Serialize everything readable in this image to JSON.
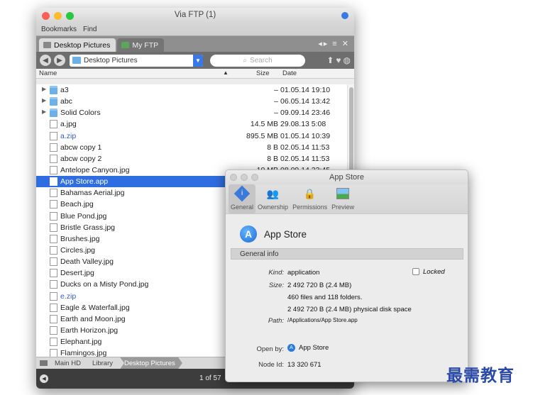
{
  "window": {
    "title": "Via FTP (1)"
  },
  "menu": [
    "Bookmarks",
    "Find"
  ],
  "tabs": [
    {
      "label": "Desktop Pictures"
    },
    {
      "label": "My FTP"
    }
  ],
  "toolbar": {
    "path": "Desktop Pictures",
    "search_placeholder": "Search"
  },
  "columns": {
    "name": "Name",
    "size": "Size",
    "date": "Date"
  },
  "files": [
    {
      "name": "a3",
      "size": "–",
      "date": "01.05.14 19:10",
      "type": "folder"
    },
    {
      "name": "abc",
      "size": "–",
      "date": "06.05.14 13:42",
      "type": "folder"
    },
    {
      "name": "Solid Colors",
      "size": "–",
      "date": "09.09.14 23:46",
      "type": "folder"
    },
    {
      "name": "a.jpg",
      "size": "14.5 MB",
      "date": "29.08.13 5:08",
      "type": "file"
    },
    {
      "name": "a.zip",
      "size": "895.5 MB",
      "date": "01.05.14 10:39",
      "type": "zip"
    },
    {
      "name": "abcw copy 1",
      "size": "8 B",
      "date": "02.05.14 11:53",
      "type": "file"
    },
    {
      "name": "abcw copy 2",
      "size": "8 B",
      "date": "02.05.14 11:53",
      "type": "file"
    },
    {
      "name": "Antelope Canyon.jpg",
      "size": "10 MB",
      "date": "08.09.14 23:45",
      "type": "file"
    },
    {
      "name": "App Store.app",
      "size": "",
      "date": "",
      "type": "file",
      "selected": true
    },
    {
      "name": "Bahamas Aerial.jpg",
      "size": "",
      "date": "",
      "type": "file"
    },
    {
      "name": "Beach.jpg",
      "size": "",
      "date": "",
      "type": "file"
    },
    {
      "name": "Blue Pond.jpg",
      "size": "",
      "date": "",
      "type": "file"
    },
    {
      "name": "Bristle Grass.jpg",
      "size": "",
      "date": "",
      "type": "file"
    },
    {
      "name": "Brushes.jpg",
      "size": "",
      "date": "",
      "type": "file"
    },
    {
      "name": "Circles.jpg",
      "size": "",
      "date": "",
      "type": "file"
    },
    {
      "name": "Death Valley.jpg",
      "size": "",
      "date": "",
      "type": "file"
    },
    {
      "name": "Desert.jpg",
      "size": "",
      "date": "",
      "type": "file"
    },
    {
      "name": "Ducks on a Misty Pond.jpg",
      "size": "",
      "date": "",
      "type": "file"
    },
    {
      "name": "e.zip",
      "size": "",
      "date": "",
      "type": "zip"
    },
    {
      "name": "Eagle & Waterfall.jpg",
      "size": "",
      "date": "",
      "type": "file"
    },
    {
      "name": "Earth and Moon.jpg",
      "size": "",
      "date": "",
      "type": "file"
    },
    {
      "name": "Earth Horizon.jpg",
      "size": "",
      "date": "",
      "type": "file"
    },
    {
      "name": "Elephant.jpg",
      "size": "",
      "date": "",
      "type": "file"
    },
    {
      "name": "Flamingos.jpg",
      "size": "",
      "date": "",
      "type": "file"
    }
  ],
  "breadcrumbs": [
    "Main HD",
    "Library",
    "Desktop Pictures"
  ],
  "status": {
    "page": "1 of 57"
  },
  "info": {
    "title": "App Store",
    "tabs": [
      "General",
      "Ownership",
      "Permissions",
      "Preview"
    ],
    "app_name": "App Store",
    "section": "General info",
    "kind_label": "Kind:",
    "kind": "application",
    "locked_label": "Locked",
    "size_label": "Size:",
    "size": "2 492 720 B (2.4 MB)",
    "files": "460 files and 118 folders.",
    "disk": "2 492 720 B (2.4 MB) physical disk space",
    "path_label": "Path:",
    "path": "/Applications/App Store.app",
    "openby_label": "Open by:",
    "openby": "App Store",
    "nodeid_label": "Node Id:",
    "nodeid": "13 320 671"
  },
  "watermark": "最需教育"
}
